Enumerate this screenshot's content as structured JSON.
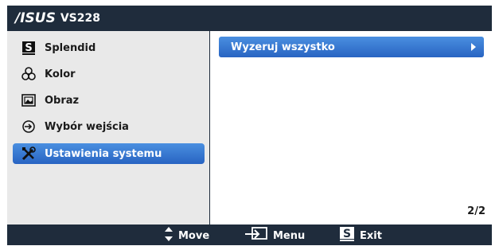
{
  "header": {
    "brand": "/ISUS",
    "model": "VS228"
  },
  "menu": {
    "items": [
      {
        "label": "Splendid",
        "icon": "splendid-s-icon",
        "selected": false
      },
      {
        "label": "Kolor",
        "icon": "color-circles-icon",
        "selected": false
      },
      {
        "label": "Obraz",
        "icon": "picture-icon",
        "selected": false
      },
      {
        "label": "Wybór wejścia",
        "icon": "input-select-icon",
        "selected": false
      },
      {
        "label": "Ustawienia systemu",
        "icon": "tools-icon",
        "selected": true
      }
    ]
  },
  "submenu": {
    "items": [
      {
        "label": "Wyzeruj wszystko"
      }
    ],
    "page": "2/2"
  },
  "footer": {
    "move_label": "Move",
    "menu_label": "Menu",
    "exit_label": "Exit",
    "exit_key": "S"
  },
  "colors": {
    "osd_background": "#1f2c3c",
    "left_panel": "#e9e9e9",
    "selection": "#2f6fcc"
  }
}
